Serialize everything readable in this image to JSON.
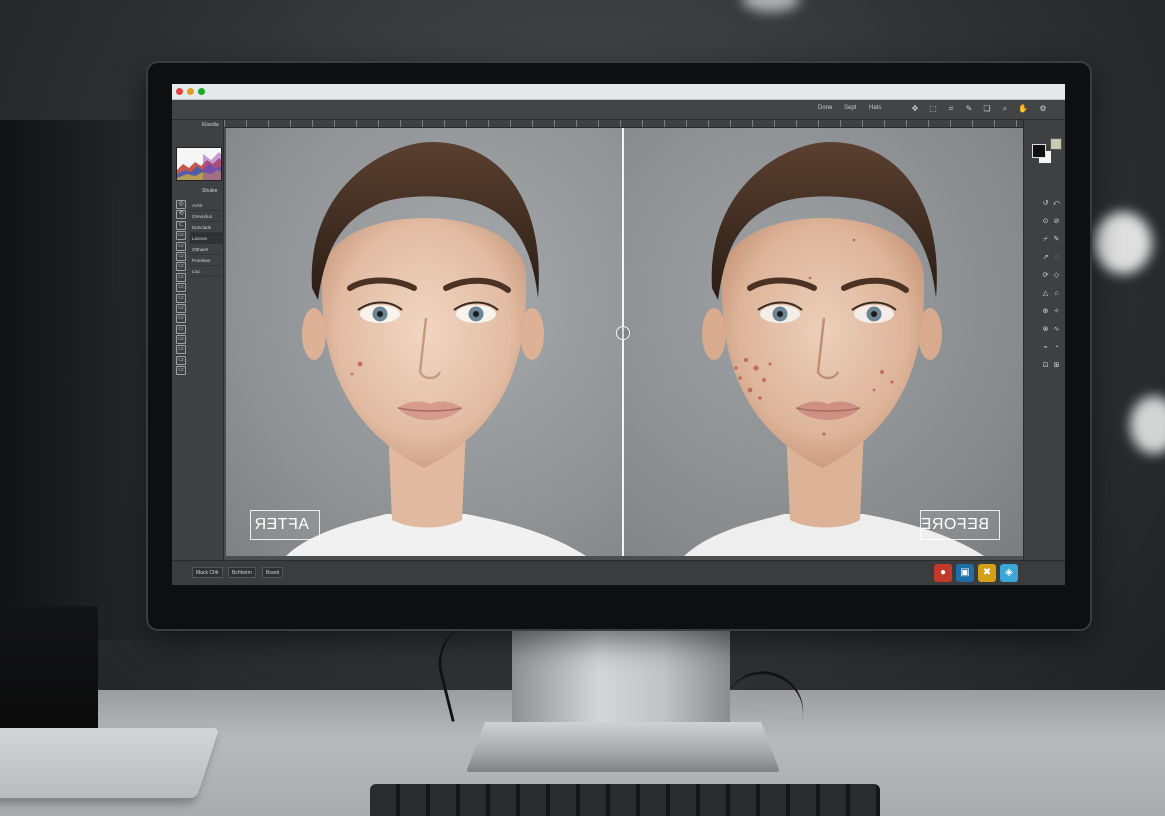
{
  "window": {
    "title": "",
    "options_bar": {
      "items": [
        "Done",
        "Sept",
        "Hats"
      ],
      "icons": [
        "move-icon",
        "select-icon",
        "crop-icon",
        "brush-icon",
        "layers-icon",
        "search-icon"
      ]
    }
  },
  "left_panel": {
    "tabs": [
      "Eluedia",
      "Shulee"
    ],
    "layers": [
      "Achit",
      "Grevndun",
      "Dunclads",
      "Lazeun",
      "Otthaeh",
      "Purelean",
      "Liuc"
    ]
  },
  "canvas": {
    "labels": {
      "after": "AFTER",
      "before": "BEFORE"
    }
  },
  "status_bar": {
    "tabs": [
      "Mack Chtt",
      "Bchhetrn",
      "Brand"
    ]
  },
  "dock": {
    "icons": [
      "record-icon",
      "finder-icon",
      "tools-icon",
      "shield-icon"
    ],
    "colors": [
      "#c0392b",
      "#1e6ea8",
      "#d4a017",
      "#3aa7d6"
    ]
  },
  "colors": {
    "accent": "#424446",
    "panel": "#3e4042",
    "screen_bg": "#4b4d4f"
  }
}
